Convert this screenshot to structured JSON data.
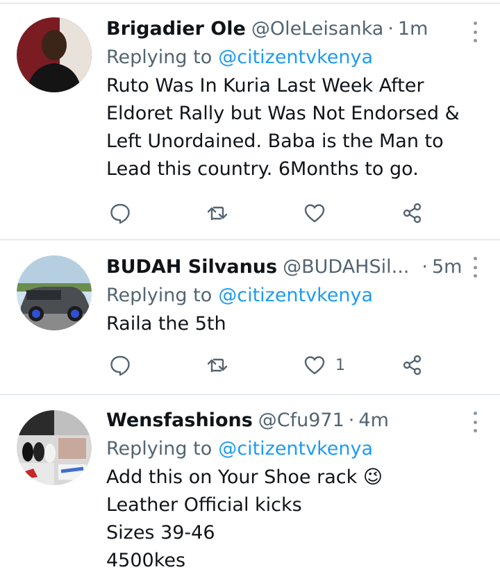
{
  "tweets": [
    {
      "name": "Brigadier Ole",
      "handle": "@OleLeisanka",
      "separator": "·",
      "time": "1m",
      "replying_prefix": "Replying to",
      "replying_to": "@citizentvkenya",
      "lines": [
        "Ruto Was In Kuria Last Week After",
        "Eldoret Rally but Was Not Endorsed  &",
        "Left Unordained. Baba is the Man to",
        "Lead this country. 6Months to go."
      ],
      "like_count": ""
    },
    {
      "name": "BUDAH Silvanus",
      "handle": "@BUDAHSil...",
      "separator": "·",
      "time": "5m",
      "replying_prefix": "Replying to",
      "replying_to": "@citizentvkenya",
      "lines": [
        "Raila the 5th"
      ],
      "like_count": "1"
    },
    {
      "name": "Wensfashions",
      "handle": "@Cfu971",
      "separator": "·",
      "time": "4m",
      "replying_prefix": "Replying to",
      "replying_to": "@citizentvkenya",
      "lines": [
        "Add this on Your Shoe rack 😉",
        "Leather Official kicks",
        "Sizes 39-46",
        "4500kes"
      ],
      "like_count": ""
    }
  ],
  "icons": {
    "reply": "reply-icon",
    "retweet": "retweet-icon",
    "like": "heart-icon",
    "share": "share-icon",
    "more": "more-options-icon"
  },
  "colors": {
    "text": "#0f1419",
    "secondary": "#536471",
    "mention": "#1d9bf0",
    "divider": "#cfd9de"
  }
}
